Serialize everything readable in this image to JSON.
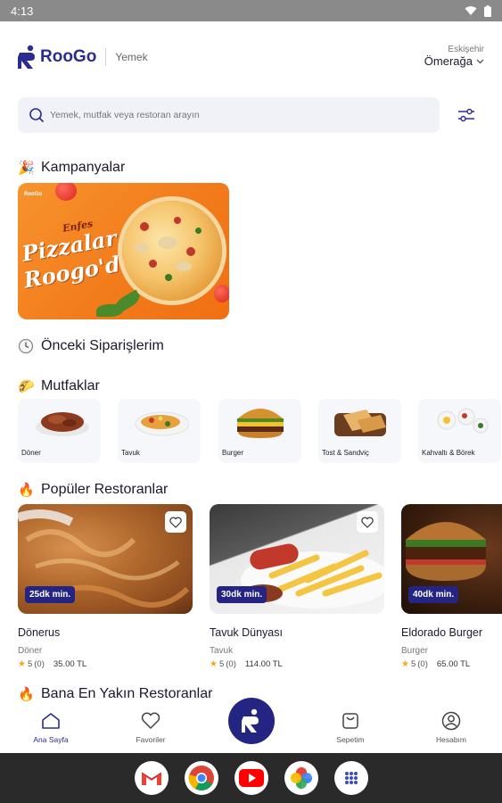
{
  "status_bar": {
    "time": "4:13"
  },
  "header": {
    "brand": "RooGo",
    "subtitle": "Yemek",
    "location_city": "Eskişehir",
    "location_district": "Ömerağa"
  },
  "search": {
    "placeholder": "Yemek, mutfak veya restoran arayın"
  },
  "sections": {
    "campaigns": {
      "title": "Kampanyalar",
      "icon": "party-popper"
    },
    "previous_orders": {
      "title": "Önceki Siparişlerim",
      "icon": "clock"
    },
    "cuisines": {
      "title": "Mutfaklar",
      "icon": "taco"
    },
    "popular": {
      "title": "Popüler Restoranlar",
      "icon": "fire"
    },
    "nearest": {
      "title": "Bana En Yakın Restoranlar",
      "icon": "fire"
    }
  },
  "campaign_banner": {
    "brand": "RooGo",
    "small_text": "Enfes",
    "line1": "Pizzalar",
    "line2": "Roogo'da"
  },
  "cuisines": [
    {
      "label": "Döner"
    },
    {
      "label": "Tavuk"
    },
    {
      "label": "Burger"
    },
    {
      "label": "Tost & Sandviç"
    },
    {
      "label": "Kahvaltı & Börek"
    }
  ],
  "restaurants": [
    {
      "name": "Dönerus",
      "category": "Döner",
      "eta": "25dk min.",
      "rating": "5",
      "reviews": "(0)",
      "min_price": "35.00 TL"
    },
    {
      "name": "Tavuk Dünyası",
      "category": "Tavuk",
      "eta": "30dk min.",
      "rating": "5",
      "reviews": "(0)",
      "min_price": "114.00 TL"
    },
    {
      "name": "Eldorado Burger",
      "category": "Burger",
      "eta": "40dk min.",
      "rating": "5",
      "reviews": "(0)",
      "min_price": "65.00 TL"
    }
  ],
  "bottom_nav": {
    "home": "Ana Sayfa",
    "favorites": "Favoriler",
    "cart": "Sepetim",
    "account": "Hesabım"
  },
  "colors": {
    "brand": "#242483",
    "accent_orange": "#f27a1a",
    "star": "#f5a623"
  }
}
